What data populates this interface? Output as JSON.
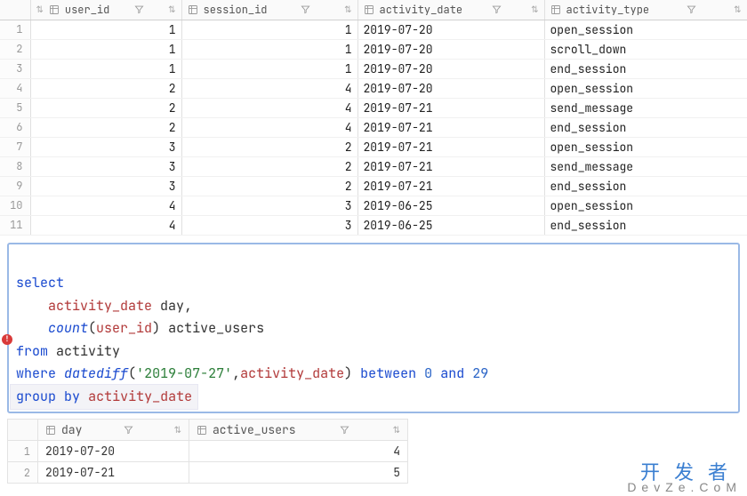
{
  "top_table": {
    "columns": [
      {
        "name": "user_id"
      },
      {
        "name": "session_id"
      },
      {
        "name": "activity_date"
      },
      {
        "name": "activity_type"
      }
    ],
    "rows": [
      {
        "n": 1,
        "user_id": 1,
        "session_id": 1,
        "activity_date": "2019-07-20",
        "activity_type": "open_session"
      },
      {
        "n": 2,
        "user_id": 1,
        "session_id": 1,
        "activity_date": "2019-07-20",
        "activity_type": "scroll_down"
      },
      {
        "n": 3,
        "user_id": 1,
        "session_id": 1,
        "activity_date": "2019-07-20",
        "activity_type": "end_session"
      },
      {
        "n": 4,
        "user_id": 2,
        "session_id": 4,
        "activity_date": "2019-07-20",
        "activity_type": "open_session"
      },
      {
        "n": 5,
        "user_id": 2,
        "session_id": 4,
        "activity_date": "2019-07-21",
        "activity_type": "send_message"
      },
      {
        "n": 6,
        "user_id": 2,
        "session_id": 4,
        "activity_date": "2019-07-21",
        "activity_type": "end_session"
      },
      {
        "n": 7,
        "user_id": 3,
        "session_id": 2,
        "activity_date": "2019-07-21",
        "activity_type": "open_session"
      },
      {
        "n": 8,
        "user_id": 3,
        "session_id": 2,
        "activity_date": "2019-07-21",
        "activity_type": "send_message"
      },
      {
        "n": 9,
        "user_id": 3,
        "session_id": 2,
        "activity_date": "2019-07-21",
        "activity_type": "end_session"
      },
      {
        "n": 10,
        "user_id": 4,
        "session_id": 3,
        "activity_date": "2019-06-25",
        "activity_type": "open_session"
      },
      {
        "n": 11,
        "user_id": 4,
        "session_id": 3,
        "activity_date": "2019-06-25",
        "activity_type": "end_session"
      }
    ]
  },
  "sql": {
    "tokens": {
      "select": "select",
      "activity_date": "activity_date",
      "day": "day",
      "comma": ",",
      "count": "count",
      "lp": "(",
      "user_id": "user_id",
      "rp": ")",
      "active_users": "active_users",
      "from": "from",
      "table": "activity",
      "where": "where",
      "datediff": "datediff",
      "strlit": "'2019-07-27'",
      "between": "between",
      "n0": "0",
      "and": "and",
      "n29": "29",
      "group": "group",
      "by": "by"
    }
  },
  "result_table": {
    "columns": [
      {
        "name": "day"
      },
      {
        "name": "active_users"
      }
    ],
    "rows": [
      {
        "n": 1,
        "day": "2019-07-20",
        "active_users": 4
      },
      {
        "n": 2,
        "day": "2019-07-21",
        "active_users": 5
      }
    ]
  },
  "watermark": {
    "line1": "开发者",
    "line2": "DevZe.CoM"
  }
}
